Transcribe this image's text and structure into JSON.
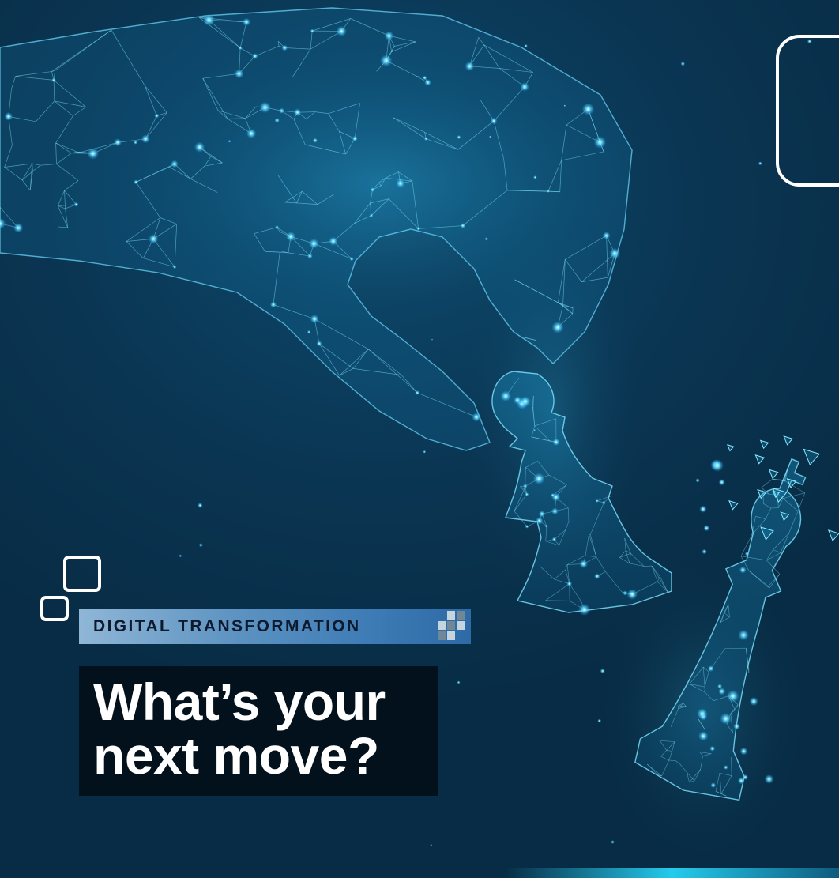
{
  "banner": {
    "label": "DIGITAL TRANSFORMATION"
  },
  "headline": {
    "line1": "What’s your",
    "line2": "next move?"
  },
  "colors": {
    "background": "#0a3350",
    "glow": "#38c8ff",
    "banner_start": "#8fb6d6",
    "banner_end": "#2d6aa6",
    "headline_bg": "#03111d",
    "text_white": "#ffffff"
  },
  "icons": [
    "wireframe-hand-icon",
    "pawn-icon",
    "king-icon",
    "rounded-square-icon",
    "pixel-grid-icon"
  ]
}
